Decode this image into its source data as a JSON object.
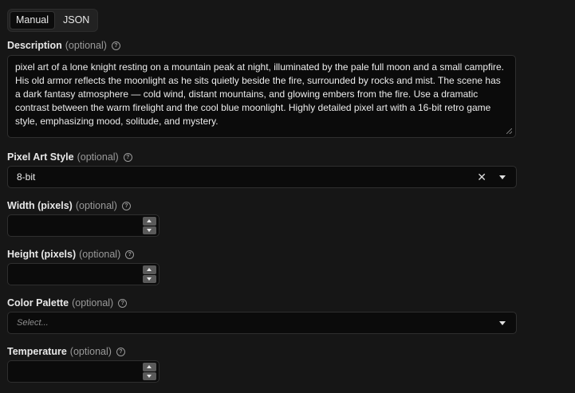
{
  "tabs": [
    {
      "label": "Manual",
      "active": true
    },
    {
      "label": "JSON",
      "active": false
    }
  ],
  "description": {
    "label": "Description",
    "optional": "(optional)",
    "value": "pixel art of a lone knight resting on a mountain peak at night, illuminated by the pale full moon and a small campfire. His old armor reflects the moonlight as he sits quietly beside the fire, surrounded by rocks and mist. The scene has a dark fantasy atmosphere — cold wind, distant mountains, and glowing embers from the fire. Use a dramatic contrast between the warm firelight and the cool blue moonlight. Highly detailed pixel art with a 16-bit retro game style, emphasizing mood, solitude, and mystery."
  },
  "pixel_art_style": {
    "label": "Pixel Art Style",
    "optional": "(optional)",
    "value": "8-bit"
  },
  "width": {
    "label": "Width (pixels)",
    "optional": "(optional)",
    "value": ""
  },
  "height": {
    "label": "Height (pixels)",
    "optional": "(optional)",
    "value": ""
  },
  "color_palette": {
    "label": "Color Palette",
    "optional": "(optional)",
    "placeholder": "Select..."
  },
  "temperature": {
    "label": "Temperature",
    "optional": "(optional)",
    "value": ""
  },
  "icons": {
    "help": "help-circle-icon",
    "clear": "close-icon",
    "dropdown": "chevron-down-icon"
  },
  "colors": {
    "background": "#161616",
    "input_background": "#0b0b0b",
    "border": "#2f2f2f",
    "muted_text": "#9a9a9a"
  }
}
